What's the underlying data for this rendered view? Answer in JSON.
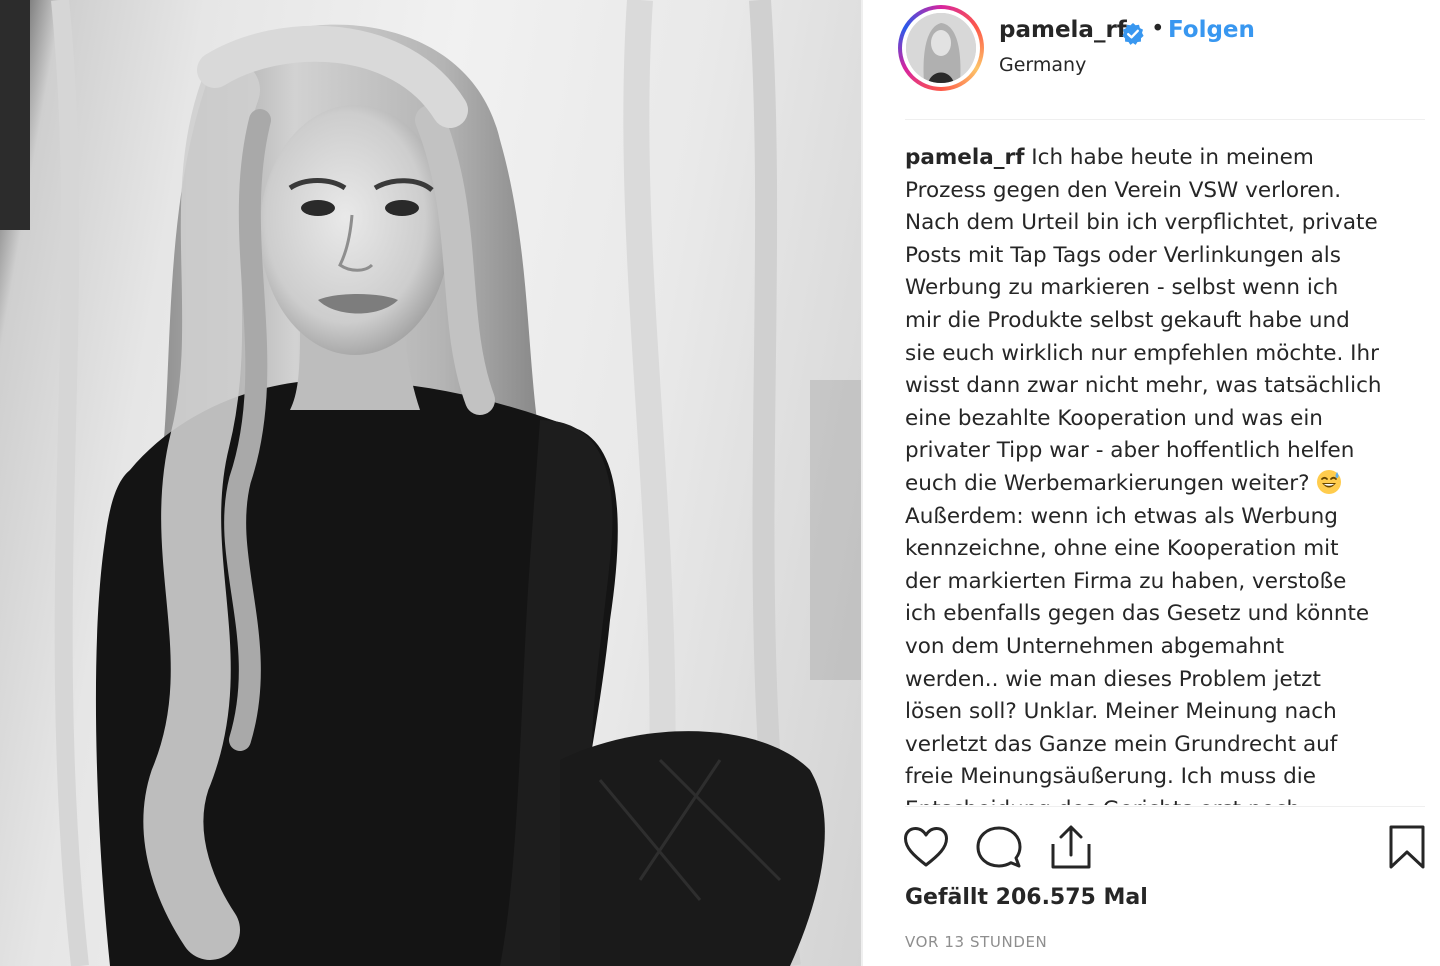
{
  "post": {
    "photo_icon": "portrait-photo",
    "author": {
      "username": "pamela_rf",
      "verified_icon": "verified-badge-icon",
      "separator": "•",
      "follow_label": "Folgen",
      "location": "Germany"
    },
    "caption": {
      "username": "pamela_rf",
      "lines": [
        " Ich habe heute in meinem",
        "Prozess gegen den Verein VSW verloren.",
        "Nach dem Urteil bin ich verpflichtet, private",
        "Posts mit Tap Tags oder Verlinkungen als",
        "Werbung zu markieren - selbst wenn ich",
        "mir die Produkte selbst gekauft habe und",
        "sie euch wirklich nur empfehlen möchte. Ihr",
        "wisst dann zwar nicht mehr, was tatsächlich",
        "eine bezahlte Kooperation und was ein",
        "privater Tipp war - aber hoffentlich helfen",
        "euch die Werbemarkierungen weiter?",
        "Außerdem: wenn ich etwas als Werbung",
        "kennzeichne, ohne eine Kooperation mit",
        "der markierten Firma zu haben, verstoße",
        "ich ebenfalls gegen das Gesetz und könnte",
        "von dem Unternehmen abgemahnt",
        "werden.. wie man dieses Problem jetzt",
        "lösen soll? Unklar. Meiner Meinung nach",
        "verletzt das Ganze mein Grundrecht auf",
        "freie Meinungsäußerung. Ich muss die",
        "Entscheidung des Gerichts erst noch"
      ],
      "emoji_icon": "sweat-smile-emoji-icon"
    },
    "actions": {
      "like_icon": "heart-icon",
      "comment_icon": "comment-icon",
      "share_icon": "share-icon",
      "save_icon": "bookmark-icon"
    },
    "likes": "Gefällt 206.575 Mal",
    "timestamp": "VOR 13 STUNDEN"
  }
}
